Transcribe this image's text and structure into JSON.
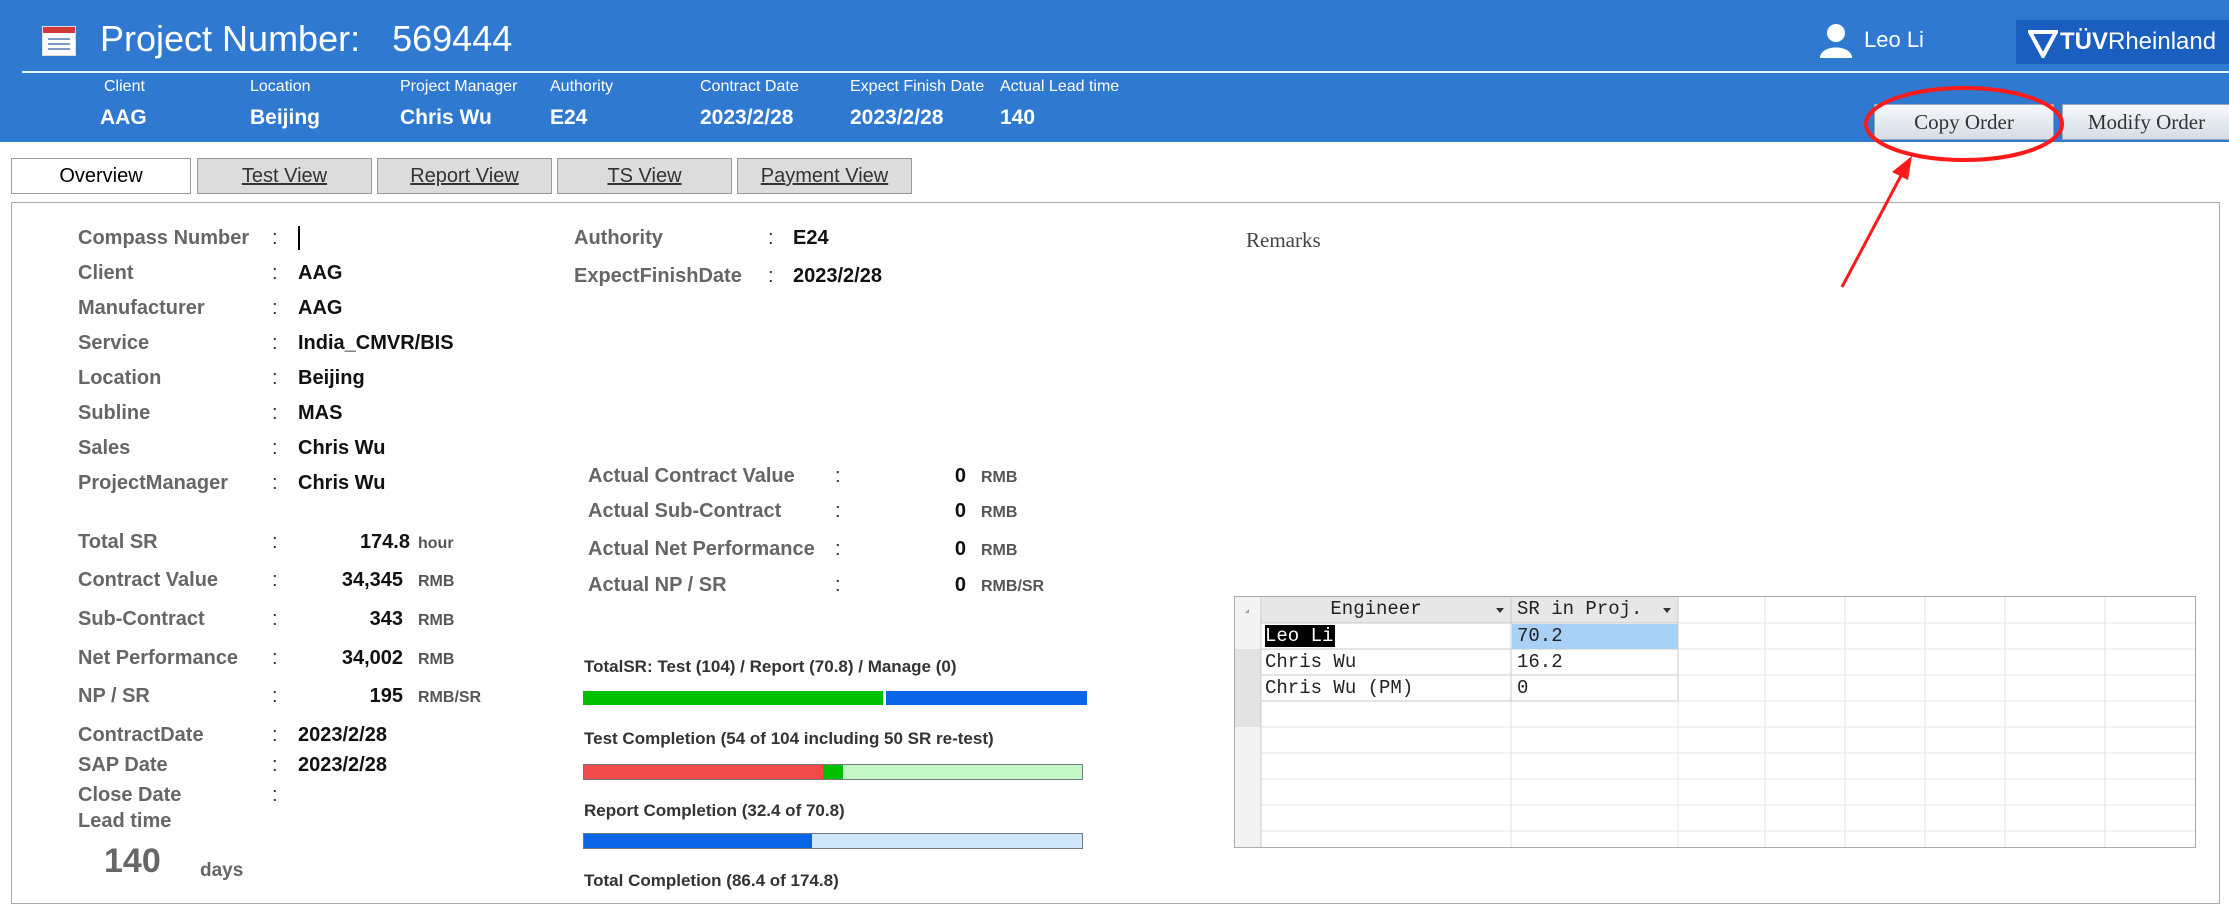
{
  "header": {
    "title_label": "Project Number:",
    "project_number": "569444",
    "user_name": "Leo Li",
    "brand_prefix": "TÜV",
    "brand_suffix": "Rheinland",
    "fields": [
      {
        "label": "Client",
        "value": "AAG"
      },
      {
        "label": "Location",
        "value": "Beijing"
      },
      {
        "label": "Project Manager",
        "value": "Chris Wu"
      },
      {
        "label": "Authority",
        "value": "E24"
      },
      {
        "label": "Contract Date",
        "value": "2023/2/28"
      },
      {
        "label": "Expect Finish Date",
        "value": "2023/2/28"
      },
      {
        "label": "Actual Lead time",
        "value": "140"
      }
    ],
    "buttons": {
      "copy_order": "Copy Order",
      "modify_order": "Modify Order"
    }
  },
  "tabs": [
    {
      "label": "Overview",
      "active": true
    },
    {
      "label": "Test View",
      "active": false
    },
    {
      "label": "Report View",
      "active": false
    },
    {
      "label": "TS View",
      "active": false
    },
    {
      "label": "Payment View",
      "active": false
    }
  ],
  "info": {
    "rows": [
      {
        "label": "Compass Number",
        "value": ""
      },
      {
        "label": "Client",
        "value": "AAG"
      },
      {
        "label": "Manufacturer",
        "value": "AAG"
      },
      {
        "label": "Service",
        "value": "India_CMVR/BIS"
      },
      {
        "label": "Location",
        "value": "Beijing"
      },
      {
        "label": "Subline",
        "value": "MAS"
      },
      {
        "label": "Sales",
        "value": "Chris Wu"
      },
      {
        "label": "ProjectManager",
        "value": "Chris Wu"
      }
    ],
    "colon": ":"
  },
  "finance": [
    {
      "label": "Total SR",
      "value": "174.8",
      "unit": "hour"
    },
    {
      "label": "Contract Value",
      "value": "34,345",
      "unit": "RMB"
    },
    {
      "label": "Sub-Contract",
      "value": "343",
      "unit": "RMB"
    },
    {
      "label": "Net Performance",
      "value": "34,002",
      "unit": "RMB"
    },
    {
      "label": "NP / SR",
      "value": "195",
      "unit": "RMB/SR"
    }
  ],
  "dates": [
    {
      "label": "ContractDate",
      "value": "2023/2/28"
    },
    {
      "label": "SAP Date",
      "value": "2023/2/28"
    },
    {
      "label": "Close Date",
      "value": ""
    }
  ],
  "lead_time": {
    "label": "Lead time",
    "value": "140",
    "unit": "days"
  },
  "middle": [
    {
      "label": "Authority",
      "value": "E24"
    },
    {
      "label": "ExpectFinishDate",
      "value": "2023/2/28"
    }
  ],
  "actuals": [
    {
      "label": "Actual Contract Value",
      "value": "0",
      "unit": "RMB"
    },
    {
      "label": "Actual Sub-Contract",
      "value": "0",
      "unit": "RMB"
    },
    {
      "label": "Actual Net Performance",
      "value": "0",
      "unit": "RMB"
    },
    {
      "label": "Actual NP / SR",
      "value": "0",
      "unit": "RMB/SR"
    }
  ],
  "progress": {
    "total_sr": {
      "title": "TotalSR: Test (104) / Report (70.8) / Manage (0)",
      "test_fraction": 0.595,
      "report_fraction": 0.405
    },
    "test": {
      "title": "Test Completion (54 of 104 including 50 SR re-test)",
      "done_fraction": 0.48,
      "retest_fraction": 0.04
    },
    "report": {
      "title": "Report Completion (32.4 of 70.8)",
      "done_fraction": 0.458
    },
    "total": {
      "title": "Total Completion (86.4 of 174.8)"
    }
  },
  "remarks": {
    "label": "Remarks"
  },
  "grid": {
    "headers": [
      "Engineer",
      "SR in Proj."
    ],
    "rows": [
      [
        "Leo Li",
        "70.2"
      ],
      [
        "Chris Wu",
        "16.2"
      ],
      [
        "Chris Wu (PM)",
        "0"
      ]
    ]
  },
  "colors": {
    "header_bg": "#2f79d1",
    "green": "#00c000",
    "blue": "#0a64e6",
    "red": "#f04a4a",
    "light_green": "#c6f7c6",
    "light_blue": "#cfe6fb",
    "annotation": "#ff1a1a"
  }
}
